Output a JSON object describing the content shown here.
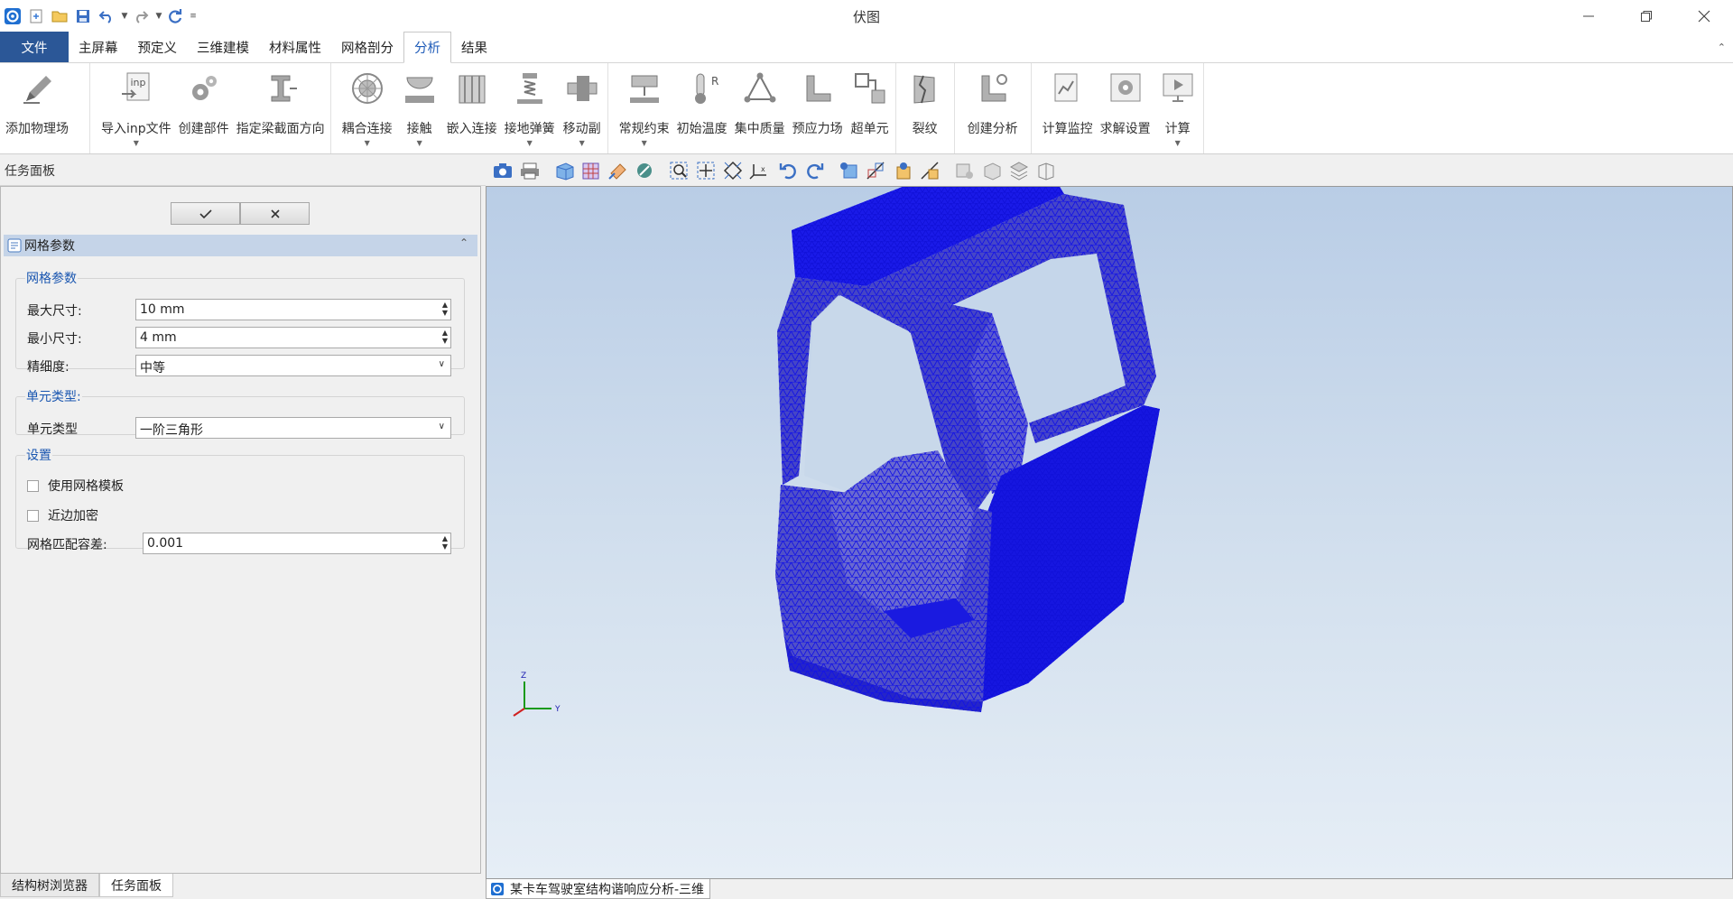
{
  "app": {
    "title": "伏图"
  },
  "tabs": [
    "文件",
    "主屏幕",
    "预定义",
    "三维建模",
    "材料属性",
    "网格剖分",
    "分析",
    "结果"
  ],
  "active_tab_index": 6,
  "ribbon": {
    "groups": [
      [
        {
          "label": "添加物理场",
          "icon": "pen-icon",
          "dropdown": false
        }
      ],
      [
        {
          "label": "导入inp文件",
          "icon": "inp-file-icon",
          "dropdown": true
        },
        {
          "label": "创建部件",
          "icon": "gears-icon",
          "dropdown": false
        },
        {
          "label": "指定梁截面方向",
          "icon": "beam-section-icon",
          "dropdown": false
        }
      ],
      [
        {
          "label": "耦合连接",
          "icon": "coupling-icon",
          "dropdown": true
        },
        {
          "label": "接触",
          "icon": "contact-icon",
          "dropdown": true
        },
        {
          "label": "嵌入连接",
          "icon": "embed-icon",
          "dropdown": false
        },
        {
          "label": "接地弹簧",
          "icon": "spring-icon",
          "dropdown": true
        },
        {
          "label": "移动副",
          "icon": "slider-joint-icon",
          "dropdown": true
        }
      ],
      [
        {
          "label": "常规约束",
          "icon": "constraint-icon",
          "dropdown": true
        },
        {
          "label": "初始温度",
          "icon": "thermometer-icon",
          "dropdown": false
        },
        {
          "label": "集中质量",
          "icon": "mass-icon",
          "dropdown": false
        },
        {
          "label": "预应力场",
          "icon": "prestress-icon",
          "dropdown": false
        },
        {
          "label": "超单元",
          "icon": "superelement-icon",
          "dropdown": false
        }
      ],
      [
        {
          "label": "裂纹",
          "icon": "crack-icon",
          "dropdown": false
        }
      ],
      [
        {
          "label": "创建分析",
          "icon": "create-analysis-icon",
          "dropdown": false
        }
      ],
      [
        {
          "label": "计算监控",
          "icon": "monitor-icon",
          "dropdown": false
        },
        {
          "label": "求解设置",
          "icon": "solver-settings-icon",
          "dropdown": false
        },
        {
          "label": "计算",
          "icon": "compute-icon",
          "dropdown": true
        }
      ]
    ]
  },
  "task_panel": {
    "title": "任务面板",
    "section_title": "网格参数",
    "groups": {
      "mesh_params": {
        "legend": "网格参数",
        "max_size_label": "最大尺寸:",
        "max_size_value": "10 mm",
        "min_size_label": "最小尺寸:",
        "min_size_value": "4 mm",
        "fineness_label": "精细度:",
        "fineness_value": "中等"
      },
      "element_type": {
        "legend": "单元类型:",
        "type_label": "单元类型",
        "type_value": "一阶三角形"
      },
      "settings": {
        "legend": "设置",
        "use_template_label": "使用网格模板",
        "use_template_checked": false,
        "edge_refine_label": "近边加密",
        "edge_refine_checked": false,
        "tolerance_label": "网格匹配容差:",
        "tolerance_value": "0.001"
      }
    }
  },
  "bottom_tabs": [
    "结构树浏览器",
    "任务面板"
  ],
  "active_bottom_tab": 1,
  "viewport": {
    "doc_tab_label": "某卡车驾驶室结构谐响应分析-三维",
    "mesh_color": "#1010e8",
    "axis": {
      "z": "Z",
      "y": "Y"
    }
  },
  "colors": {
    "file_tab": "#2b5797",
    "active_tab_text": "#1e5bb8",
    "section_header": "#c5d4e8"
  }
}
